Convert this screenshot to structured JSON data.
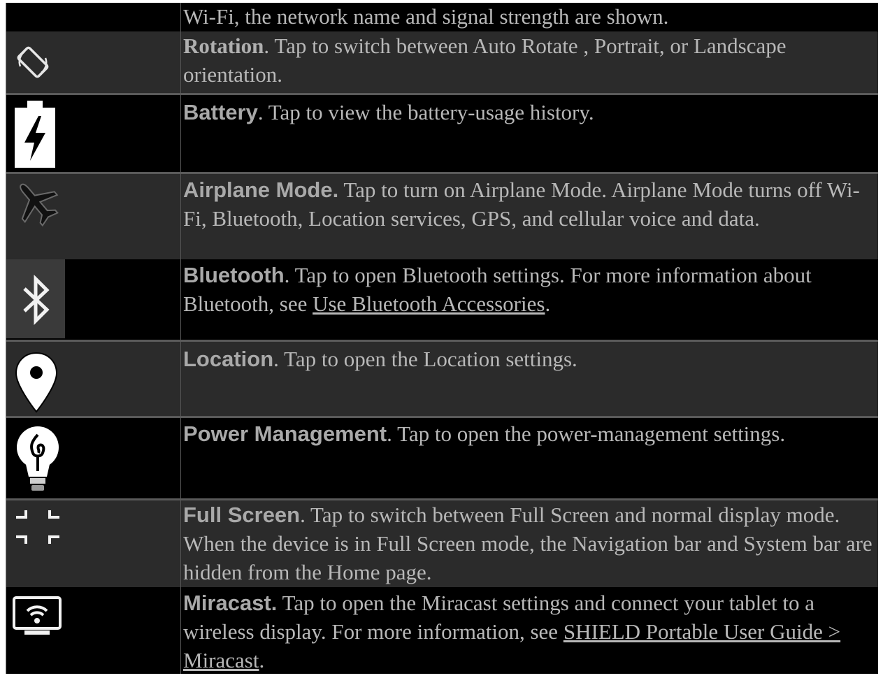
{
  "rows": [
    {
      "id": "wifi",
      "text": "Wi-Fi, the network name and signal strength are shown."
    },
    {
      "id": "rotation",
      "term": "Rotation",
      "text": ". Tap to switch between Auto Rotate , Portrait, or Landscape orientation.",
      "icon": "screen-rotation-icon"
    },
    {
      "id": "battery",
      "term": "Battery",
      "text": ". Tap to view the battery-usage history.",
      "icon": "battery-charging-icon"
    },
    {
      "id": "airplane",
      "term": "Airplane Mode.",
      "text": " Tap to turn on Airplane Mode. Airplane Mode turns off Wi-Fi, Bluetooth, Location services, GPS, and cellular voice and data.",
      "icon": "airplane-icon"
    },
    {
      "id": "bluetooth",
      "term": "Bluetooth",
      "text": ". Tap to open Bluetooth settings. For more information about Bluetooth, see ",
      "link": "Use Bluetooth Accessories",
      "after": ".",
      "icon": "bluetooth-icon"
    },
    {
      "id": "location",
      "term": "Location",
      "text": ". Tap to open the Location settings.",
      "icon": "location-pin-icon"
    },
    {
      "id": "power",
      "term": "Power Management",
      "text": ". Tap to open the power-management settings.",
      "icon": "power-bulb-icon"
    },
    {
      "id": "fullscreen",
      "term": "Full Screen",
      "text": ". Tap to switch between Full Screen and normal display mode. When the device is in Full Screen mode, the Navigation bar and System bar are hidden from the Home page.",
      "icon": "fullscreen-exit-icon"
    },
    {
      "id": "miracast",
      "term": "Miracast.",
      "text": " Tap to open the Miracast settings and connect your tablet to a wireless display. For more information, see ",
      "link": "SHIELD Portable User Guide > Miracast",
      "after": ".",
      "icon": "miracast-icon"
    }
  ]
}
